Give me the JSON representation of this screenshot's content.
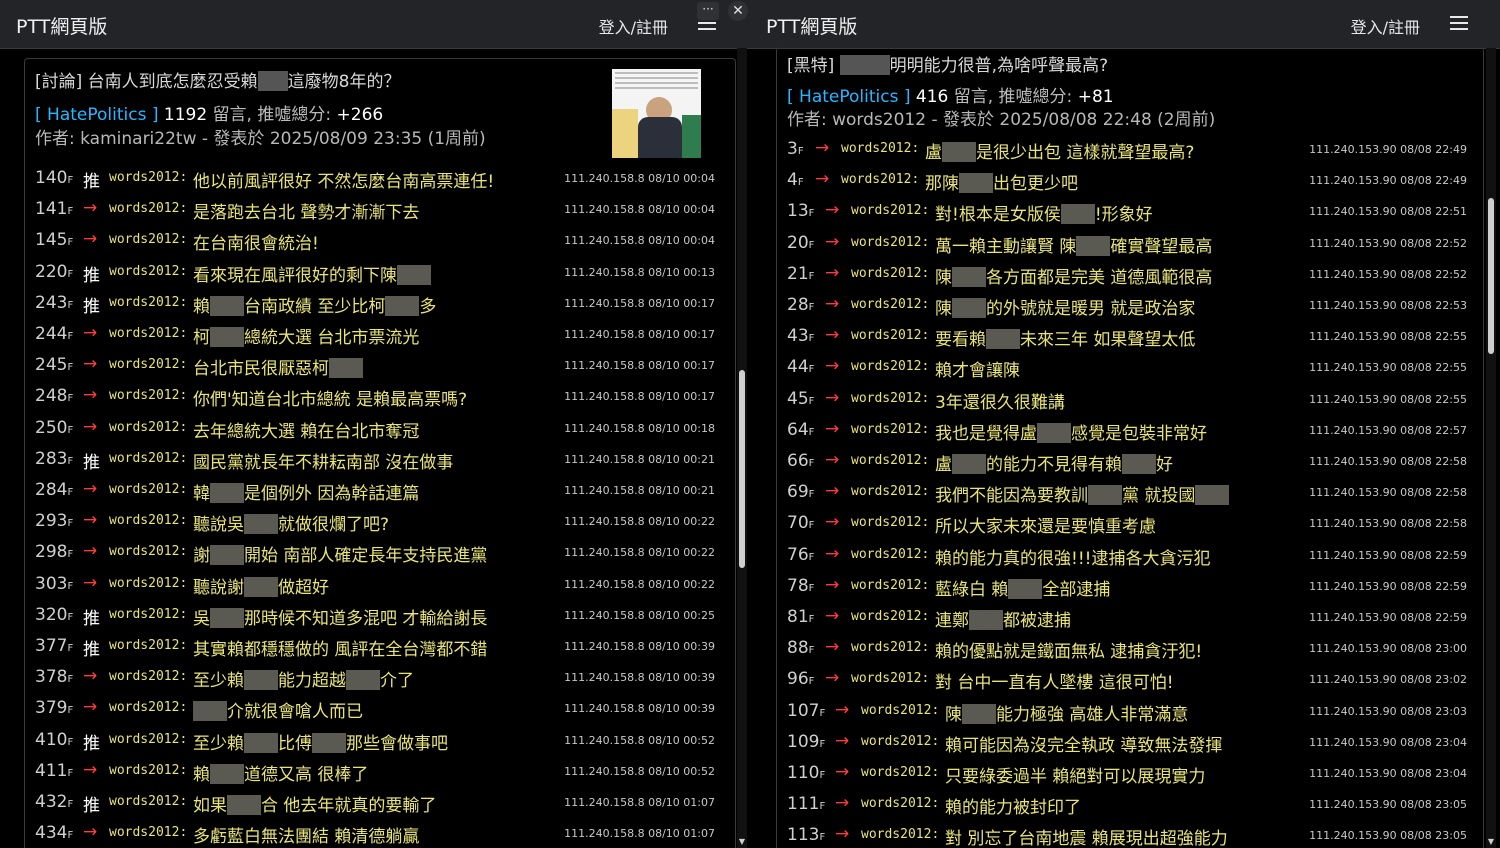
{
  "controls": {
    "more_label": "···",
    "close_label": "✕"
  },
  "left": {
    "site_title": "PTT網頁版",
    "login": "登入/註冊",
    "post": {
      "title": "[討論] 台南人到底怎麼忍受賴",
      "title_end": "這廢物8年的？",
      "board": "[ HatePolitics ]",
      "comment_count": "1192",
      "comment_label": "留言, 推噓總分:",
      "score": "+266",
      "author_line": "作者: kaminari22tw - 發表於 2025/08/09 23:35 (1周前)"
    },
    "comments": [
      {
        "floor": "140",
        "tag": "推",
        "user": "words2012",
        "parts": [
          "他以前風評很好 不然怎麼台南高票連任!"
        ],
        "meta": "111.240.158.8 08/10 00:04"
      },
      {
        "floor": "141",
        "tag": "→",
        "user": "words2012",
        "parts": [
          "是落跑去台北 聲勢才漸漸下去"
        ],
        "meta": "111.240.158.8 08/10 00:04"
      },
      {
        "floor": "145",
        "tag": "→",
        "user": "words2012",
        "parts": [
          "在台南很會統治!"
        ],
        "meta": "111.240.158.8 08/10 00:04"
      },
      {
        "floor": "220",
        "tag": "推",
        "user": "words2012",
        "parts": [
          "看來現在風評很好的剩下陳",
          ""
        ],
        "meta": "111.240.158.8 08/10 00:13"
      },
      {
        "floor": "243",
        "tag": "推",
        "user": "words2012",
        "parts": [
          "賴",
          "台南政績 至少比柯",
          "多"
        ],
        "meta": "111.240.158.8 08/10 00:17"
      },
      {
        "floor": "244",
        "tag": "→",
        "user": "words2012",
        "parts": [
          "柯",
          "總統大選 台北市票流光"
        ],
        "meta": "111.240.158.8 08/10 00:17"
      },
      {
        "floor": "245",
        "tag": "→",
        "user": "words2012",
        "parts": [
          "台北市民很厭惡柯",
          ""
        ],
        "meta": "111.240.158.8 08/10 00:17"
      },
      {
        "floor": "248",
        "tag": "→",
        "user": "words2012",
        "parts": [
          "你們'知道台北市總統 是賴最高票嗎?"
        ],
        "meta": "111.240.158.8 08/10 00:17"
      },
      {
        "floor": "250",
        "tag": "→",
        "user": "words2012",
        "parts": [
          "去年總統大選 賴在台北市奪冠"
        ],
        "meta": "111.240.158.8 08/10 00:18"
      },
      {
        "floor": "283",
        "tag": "推",
        "user": "words2012",
        "parts": [
          "國民黨就長年不耕耘南部 沒在做事"
        ],
        "meta": "111.240.158.8 08/10 00:21"
      },
      {
        "floor": "284",
        "tag": "→",
        "user": "words2012",
        "parts": [
          "韓",
          "是個例外 因為幹話連篇"
        ],
        "meta": "111.240.158.8 08/10 00:21"
      },
      {
        "floor": "293",
        "tag": "→",
        "user": "words2012",
        "parts": [
          "聽說吳",
          "就做很爛了吧?"
        ],
        "meta": "111.240.158.8 08/10 00:22"
      },
      {
        "floor": "298",
        "tag": "→",
        "user": "words2012",
        "parts": [
          "謝",
          "開始 南部人確定長年支持民進黨"
        ],
        "meta": "111.240.158.8 08/10 00:22"
      },
      {
        "floor": "303",
        "tag": "→",
        "user": "words2012",
        "parts": [
          "聽說謝",
          "做超好"
        ],
        "meta": "111.240.158.8 08/10 00:22"
      },
      {
        "floor": "320",
        "tag": "推",
        "user": "words2012",
        "parts": [
          "吳",
          "那時候不知道多混吧 才輸給謝長"
        ],
        "meta": "111.240.158.8 08/10 00:25"
      },
      {
        "floor": "377",
        "tag": "推",
        "user": "words2012",
        "parts": [
          "其實賴都穩穩做的 風評在全台灣都不錯"
        ],
        "meta": "111.240.158.8 08/10 00:39"
      },
      {
        "floor": "378",
        "tag": "→",
        "user": "words2012",
        "parts": [
          "至少賴",
          "能力超越",
          "介了"
        ],
        "meta": "111.240.158.8 08/10 00:39"
      },
      {
        "floor": "379",
        "tag": "→",
        "user": "words2012",
        "parts": [
          "",
          "介就很會嗆人而已"
        ],
        "meta": "111.240.158.8 08/10 00:39"
      },
      {
        "floor": "410",
        "tag": "推",
        "user": "words2012",
        "parts": [
          "至少賴",
          "比傅",
          "那些會做事吧"
        ],
        "meta": "111.240.158.8 08/10 00:52"
      },
      {
        "floor": "411",
        "tag": "→",
        "user": "words2012",
        "parts": [
          "賴",
          "道德又高 很棒了"
        ],
        "meta": "111.240.158.8 08/10 00:52"
      },
      {
        "floor": "432",
        "tag": "推",
        "user": "words2012",
        "parts": [
          "如果",
          "合 他去年就真的要輸了"
        ],
        "meta": "111.240.158.8 08/10 01:07"
      },
      {
        "floor": "434",
        "tag": "→",
        "user": "words2012",
        "parts": [
          "多虧藍白無法團結 賴清德躺贏"
        ],
        "meta": "111.240.158.8 08/10 01:07"
      }
    ]
  },
  "right": {
    "site_title": "PTT網頁版",
    "login": "登入/註冊",
    "post": {
      "title": "[黑特]",
      "title_end": "明明能力很普,為啥呼聲最高?",
      "board": "[ HatePolitics ]",
      "comment_count": "416",
      "comment_label": "留言, 推噓總分:",
      "score": "+81",
      "author_line": "作者: words2012 - 發表於 2025/08/08 22:48 (2周前)"
    },
    "comments": [
      {
        "floor": "3",
        "tag": "→",
        "user": "words2012",
        "parts": [
          "盧",
          "是很少出包 這樣就聲望最高?"
        ],
        "meta": "111.240.153.90 08/08 22:49"
      },
      {
        "floor": "4",
        "tag": "→",
        "user": "words2012",
        "parts": [
          "那陳",
          "出包更少吧"
        ],
        "meta": "111.240.153.90 08/08 22:49"
      },
      {
        "floor": "13",
        "tag": "→",
        "user": "words2012",
        "parts": [
          "對!根本是女版侯",
          "!形象好"
        ],
        "meta": "111.240.153.90 08/08 22:51"
      },
      {
        "floor": "20",
        "tag": "→",
        "user": "words2012",
        "parts": [
          "萬一賴主動讓賢 陳",
          "確實聲望最高"
        ],
        "meta": "111.240.153.90 08/08 22:52"
      },
      {
        "floor": "21",
        "tag": "→",
        "user": "words2012",
        "parts": [
          "陳",
          "各方面都是完美 道德風範很高"
        ],
        "meta": "111.240.153.90 08/08 22:52"
      },
      {
        "floor": "28",
        "tag": "→",
        "user": "words2012",
        "parts": [
          "陳",
          "的外號就是暖男 就是政治家"
        ],
        "meta": "111.240.153.90 08/08 22:53"
      },
      {
        "floor": "43",
        "tag": "→",
        "user": "words2012",
        "parts": [
          "要看賴",
          "未來三年 如果聲望太低"
        ],
        "meta": "111.240.153.90 08/08 22:55"
      },
      {
        "floor": "44",
        "tag": "→",
        "user": "words2012",
        "parts": [
          "賴才會讓陳"
        ],
        "meta": "111.240.153.90 08/08 22:55"
      },
      {
        "floor": "45",
        "tag": "→",
        "user": "words2012",
        "parts": [
          "3年還很久很難講"
        ],
        "meta": "111.240.153.90 08/08 22:55"
      },
      {
        "floor": "64",
        "tag": "→",
        "user": "words2012",
        "parts": [
          "我也是覺得盧",
          "感覺是包裝非常好"
        ],
        "meta": "111.240.153.90 08/08 22:57"
      },
      {
        "floor": "66",
        "tag": "→",
        "user": "words2012",
        "parts": [
          "盧",
          "的能力不見得有賴",
          "好"
        ],
        "meta": "111.240.153.90 08/08 22:58"
      },
      {
        "floor": "69",
        "tag": "→",
        "user": "words2012",
        "parts": [
          "我們不能因為要教訓",
          "黨 就投國",
          ""
        ],
        "meta": "111.240.153.90 08/08 22:58"
      },
      {
        "floor": "70",
        "tag": "→",
        "user": "words2012",
        "parts": [
          "所以大家未來還是要慎重考慮"
        ],
        "meta": "111.240.153.90 08/08 22:58"
      },
      {
        "floor": "76",
        "tag": "→",
        "user": "words2012",
        "parts": [
          "賴的能力真的很強!!!逮捕各大貪污犯"
        ],
        "meta": "111.240.153.90 08/08 22:59"
      },
      {
        "floor": "78",
        "tag": "→",
        "user": "words2012",
        "parts": [
          "藍綠白 賴",
          "全部逮捕"
        ],
        "meta": "111.240.153.90 08/08 22:59"
      },
      {
        "floor": "81",
        "tag": "→",
        "user": "words2012",
        "parts": [
          "連鄭",
          "都被逮捕"
        ],
        "meta": "111.240.153.90 08/08 22:59"
      },
      {
        "floor": "88",
        "tag": "→",
        "user": "words2012",
        "parts": [
          "賴的優點就是鐵面無私 逮捕貪汙犯!"
        ],
        "meta": "111.240.153.90 08/08 23:00"
      },
      {
        "floor": "96",
        "tag": "→",
        "user": "words2012",
        "parts": [
          "對 台中一直有人墜樓 這很可怕!"
        ],
        "meta": "111.240.153.90 08/08 23:02"
      },
      {
        "floor": "107",
        "tag": "→",
        "user": "words2012",
        "parts": [
          "陳",
          "能力極強 高雄人非常滿意"
        ],
        "meta": "111.240.153.90 08/08 23:03"
      },
      {
        "floor": "109",
        "tag": "→",
        "user": "words2012",
        "parts": [
          "賴可能因為沒完全執政 導致無法發揮"
        ],
        "meta": "111.240.153.90 08/08 23:04"
      },
      {
        "floor": "110",
        "tag": "→",
        "user": "words2012",
        "parts": [
          "只要綠委過半 賴絕對可以展現實力"
        ],
        "meta": "111.240.153.90 08/08 23:04"
      },
      {
        "floor": "111",
        "tag": "→",
        "user": "words2012",
        "parts": [
          "賴的能力被封印了"
        ],
        "meta": "111.240.153.90 08/08 23:05"
      },
      {
        "floor": "113",
        "tag": "→",
        "user": "words2012",
        "parts": [
          "對 別忘了台南地震 賴展現出超強能力"
        ],
        "meta": "111.240.153.90 08/08 23:05"
      }
    ]
  }
}
